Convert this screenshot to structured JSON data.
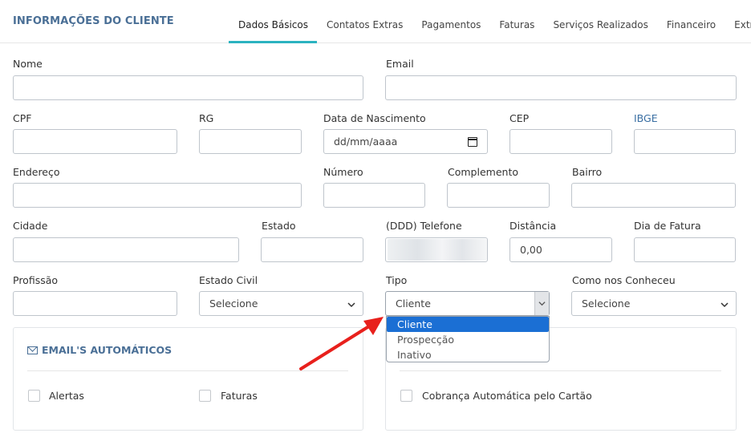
{
  "header": {
    "title": "INFORMAÇÕES DO CLIENTE",
    "tabs": [
      "Dados Básicos",
      "Contatos Extras",
      "Pagamentos",
      "Faturas",
      "Serviços Realizados",
      "Financeiro",
      "Extras"
    ],
    "active_tab": "Dados Básicos"
  },
  "form": {
    "nome": {
      "label": "Nome",
      "value": ""
    },
    "email": {
      "label": "Email",
      "value": ""
    },
    "cpf": {
      "label": "CPF",
      "value": ""
    },
    "rg": {
      "label": "RG",
      "value": ""
    },
    "nascimento": {
      "label": "Data de Nascimento",
      "value": "dd/mm/aaaa"
    },
    "cep": {
      "label": "CEP",
      "value": ""
    },
    "ibge": {
      "label": "IBGE",
      "value": ""
    },
    "endereco": {
      "label": "Endereço",
      "value": ""
    },
    "numero": {
      "label": "Número",
      "value": ""
    },
    "complemento": {
      "label": "Complemento",
      "value": ""
    },
    "bairro": {
      "label": "Bairro",
      "value": ""
    },
    "cidade": {
      "label": "Cidade",
      "value": ""
    },
    "estado": {
      "label": "Estado",
      "value": ""
    },
    "telefone": {
      "label": "(DDD) Telefone",
      "value": ""
    },
    "distancia": {
      "label": "Distância",
      "value": "0,00"
    },
    "dia_fatura": {
      "label": "Dia de Fatura",
      "value": ""
    },
    "profissao": {
      "label": "Profissão",
      "value": ""
    },
    "estado_civil": {
      "label": "Estado Civil",
      "value": "Selecione"
    },
    "tipo": {
      "label": "Tipo",
      "value": "Cliente",
      "options": [
        "Cliente",
        "Prospecção",
        "Inativo"
      ],
      "selected_index": 0
    },
    "como_conheceu": {
      "label": "Como nos Conheceu",
      "value": "Selecione"
    }
  },
  "emails_panel": {
    "title": "EMAIL'S AUTOMÁTICOS",
    "checkboxes": [
      {
        "label": "Alertas",
        "checked": false
      },
      {
        "label": "Faturas",
        "checked": false
      }
    ]
  },
  "right_panel": {
    "checkboxes": [
      {
        "label": "Cobrança Automática pelo Cartão",
        "checked": false
      }
    ]
  },
  "colors": {
    "title_blue": "#4a6f96",
    "tab_underline": "#2bb3c0",
    "option_highlight": "#1b6fd4",
    "annotation_arrow": "#e8201c"
  }
}
